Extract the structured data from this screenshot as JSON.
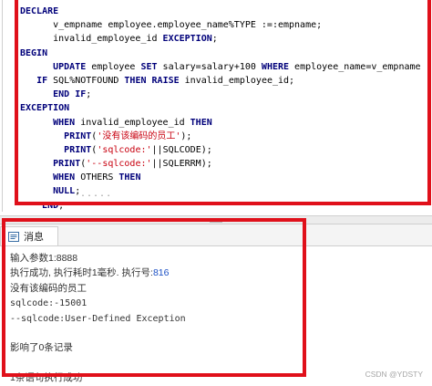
{
  "editor": {
    "lines": [
      {
        "parts": [
          {
            "t": "DECLARE",
            "k": "kw"
          }
        ]
      },
      {
        "parts": [
          {
            "t": "      v_empname employee.employee_name%TYPE :=:empname;",
            "k": ""
          }
        ]
      },
      {
        "parts": [
          {
            "t": "      invalid_employee_id ",
            "k": ""
          },
          {
            "t": "EXCEPTION",
            "k": "kw"
          },
          {
            "t": ";",
            "k": ""
          }
        ]
      },
      {
        "parts": [
          {
            "t": "BEGIN",
            "k": "kw"
          }
        ]
      },
      {
        "parts": [
          {
            "t": "      ",
            "k": ""
          },
          {
            "t": "UPDATE",
            "k": "kw"
          },
          {
            "t": " employee ",
            "k": ""
          },
          {
            "t": "SET",
            "k": "kw"
          },
          {
            "t": " salary=salary+100 ",
            "k": ""
          },
          {
            "t": "WHERE",
            "k": "kw"
          },
          {
            "t": " employee_name=v_empname",
            "k": ""
          }
        ]
      },
      {
        "parts": [
          {
            "t": "   ",
            "k": ""
          },
          {
            "t": "IF",
            "k": "kw"
          },
          {
            "t": " SQL%NOTFOUND ",
            "k": ""
          },
          {
            "t": "THEN",
            "k": "kw"
          },
          {
            "t": " ",
            "k": ""
          },
          {
            "t": "RAISE",
            "k": "kw"
          },
          {
            "t": " invalid_employee_id;",
            "k": ""
          }
        ]
      },
      {
        "parts": [
          {
            "t": "      ",
            "k": ""
          },
          {
            "t": "END IF",
            "k": "kw"
          },
          {
            "t": ";",
            "k": ""
          }
        ]
      },
      {
        "parts": [
          {
            "t": "EXCEPTION",
            "k": "kw"
          }
        ]
      },
      {
        "parts": [
          {
            "t": "      ",
            "k": ""
          },
          {
            "t": "WHEN",
            "k": "kw"
          },
          {
            "t": " invalid_employee_id ",
            "k": ""
          },
          {
            "t": "THEN",
            "k": "kw"
          }
        ]
      },
      {
        "parts": [
          {
            "t": "        ",
            "k": ""
          },
          {
            "t": "PRINT",
            "k": "kw"
          },
          {
            "t": "(",
            "k": ""
          },
          {
            "t": "'没有该编码的员工'",
            "k": "str"
          },
          {
            "t": ");",
            "k": ""
          }
        ]
      },
      {
        "parts": [
          {
            "t": "        ",
            "k": ""
          },
          {
            "t": "PRINT",
            "k": "kw"
          },
          {
            "t": "(",
            "k": ""
          },
          {
            "t": "'sqlcode:'",
            "k": "str"
          },
          {
            "t": "||SQLCODE);",
            "k": ""
          }
        ]
      },
      {
        "parts": [
          {
            "t": "      ",
            "k": ""
          },
          {
            "t": "PRINT",
            "k": "kw"
          },
          {
            "t": "(",
            "k": ""
          },
          {
            "t": "'--sqlcode:'",
            "k": "str"
          },
          {
            "t": "||SQLERRM);",
            "k": ""
          }
        ]
      },
      {
        "parts": [
          {
            "t": "      ",
            "k": ""
          },
          {
            "t": "WHEN",
            "k": "kw"
          },
          {
            "t": " OTHERS ",
            "k": ""
          },
          {
            "t": "THEN",
            "k": "kw"
          }
        ]
      },
      {
        "parts": [
          {
            "t": "      ",
            "k": ""
          },
          {
            "t": "NULL",
            "k": "kw"
          },
          {
            "t": ";",
            "k": ""
          }
        ]
      },
      {
        "parts": [
          {
            "t": "    ",
            "k": ""
          },
          {
            "t": "END",
            "k": "kw"
          },
          {
            "t": ";",
            "k": ""
          }
        ]
      }
    ]
  },
  "panel": {
    "tab_label": "消息",
    "tab_icon": "message-icon",
    "messages": [
      {
        "parts": [
          {
            "t": "输入参数1:8888",
            "c": ""
          }
        ]
      },
      {
        "parts": [
          {
            "t": "执行成功, 执行耗时1毫秒. 执行号:",
            "c": ""
          },
          {
            "t": "816",
            "c": "link"
          }
        ]
      },
      {
        "parts": [
          {
            "t": "没有该编码的员工",
            "c": ""
          }
        ]
      },
      {
        "parts": [
          {
            "t": "sqlcode:-15001",
            "c": "mono"
          }
        ]
      },
      {
        "parts": [
          {
            "t": "--sqlcode:User-Defined Exception",
            "c": "mono"
          }
        ]
      },
      {
        "parts": []
      },
      {
        "parts": [
          {
            "t": "影响了0条记录",
            "c": ""
          }
        ]
      },
      {
        "parts": []
      },
      {
        "parts": [
          {
            "t": "1条语句执行成功",
            "c": ""
          }
        ]
      }
    ]
  },
  "watermark": "CSDN @YDSTY",
  "colors": {
    "highlight_box": "#e0101a",
    "keyword": "#00007a",
    "string": "#c8000f",
    "link": "#1a4fc4"
  }
}
